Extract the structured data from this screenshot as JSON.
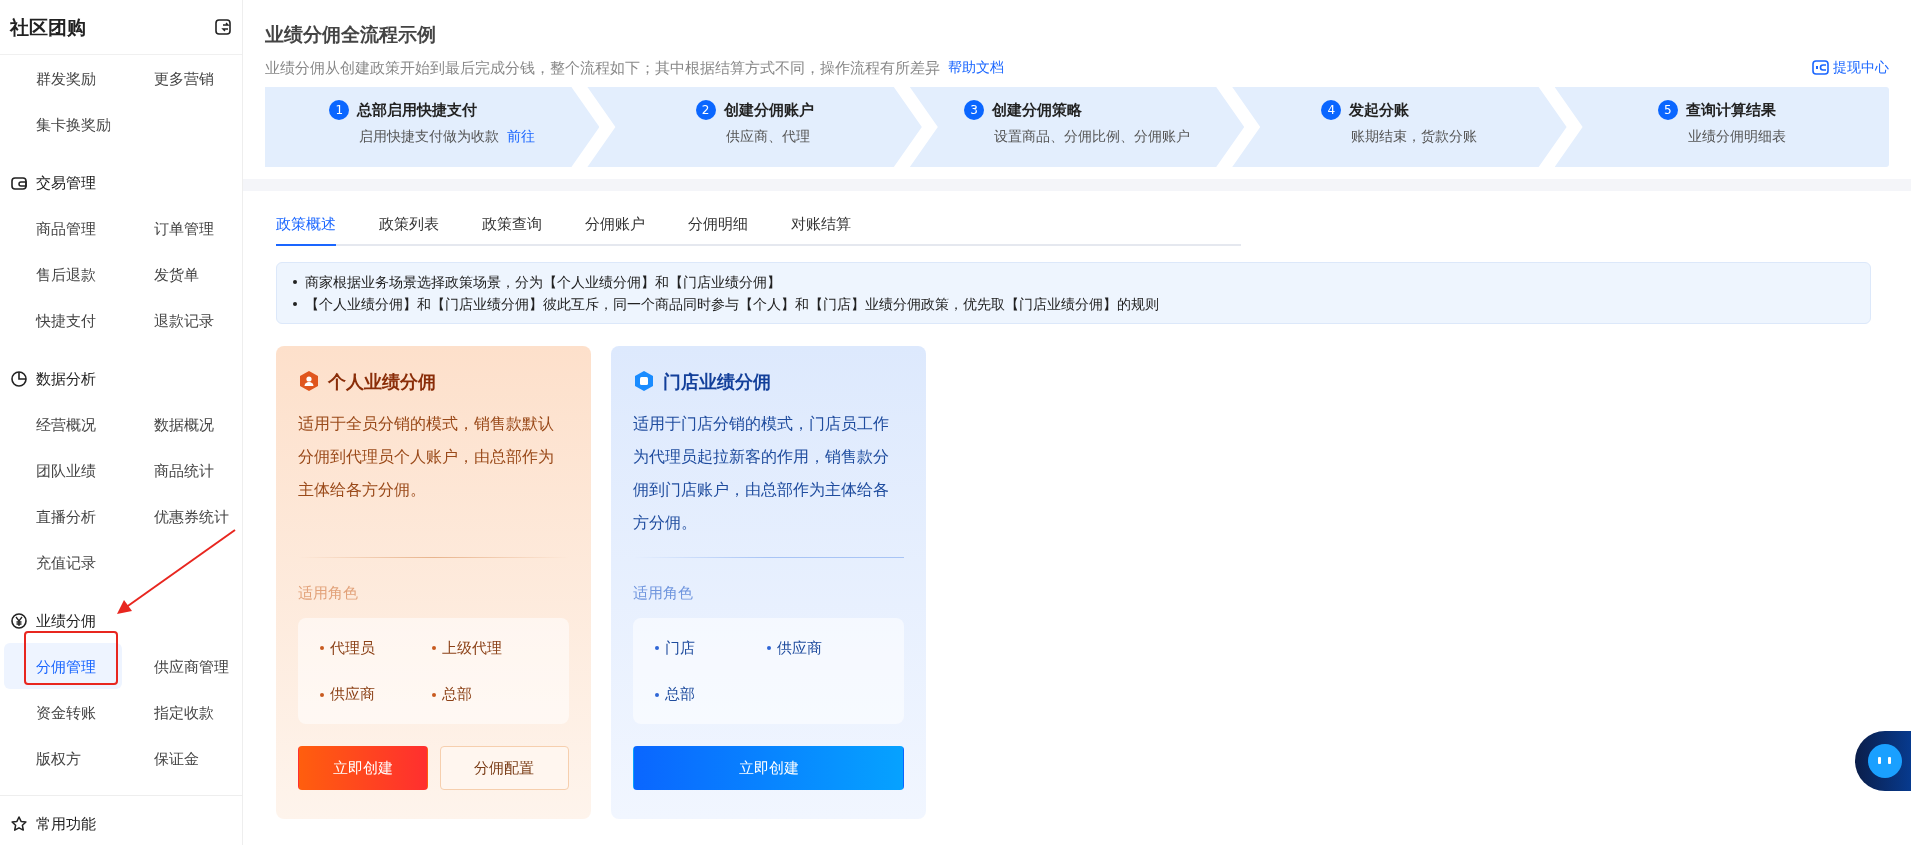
{
  "sidebar": {
    "title": "社区团购",
    "groups": [
      {
        "items": [
          {
            "label": "群发奖励",
            "selected": false
          },
          {
            "label": "更多营销",
            "selected": false
          },
          {
            "label": "集卡换奖励",
            "selected": false
          }
        ]
      },
      {
        "title": "交易管理",
        "items": [
          {
            "label": "商品管理",
            "selected": false
          },
          {
            "label": "订单管理",
            "selected": false
          },
          {
            "label": "售后退款",
            "selected": false
          },
          {
            "label": "发货单",
            "selected": false
          },
          {
            "label": "快捷支付",
            "selected": false
          },
          {
            "label": "退款记录",
            "selected": false
          }
        ]
      },
      {
        "title": "数据分析",
        "items": [
          {
            "label": "经营概况",
            "selected": false
          },
          {
            "label": "数据概况",
            "selected": false
          },
          {
            "label": "团队业绩",
            "selected": false
          },
          {
            "label": "商品统计",
            "selected": false
          },
          {
            "label": "直播分析",
            "selected": false
          },
          {
            "label": "优惠券统计",
            "selected": false
          },
          {
            "label": "充值记录",
            "selected": false
          }
        ]
      },
      {
        "title": "业绩分佣",
        "items": [
          {
            "label": "分佣管理",
            "selected": true
          },
          {
            "label": "供应商管理",
            "selected": false
          },
          {
            "label": "资金转账",
            "selected": false
          },
          {
            "label": "指定收款",
            "selected": false
          },
          {
            "label": "版权方",
            "selected": false
          },
          {
            "label": "保证金",
            "selected": false
          }
        ]
      },
      {
        "title": "常用功能"
      }
    ]
  },
  "header": {
    "title": "业绩分佣全流程示例",
    "subtitle": "业绩分佣从创建政策开始到最后完成分钱，整个流程如下；其中根据结算方式不同，操作流程有所差异",
    "help_link": "帮助文档",
    "withdraw_link": "提现中心"
  },
  "steps": [
    {
      "number": "1",
      "title": "总部启用快捷支付",
      "desc": "启用快捷支付做为收款",
      "link": "前往"
    },
    {
      "number": "2",
      "title": "创建分佣账户",
      "desc": "供应商、代理"
    },
    {
      "number": "3",
      "title": "创建分佣策略",
      "desc": "设置商品、分佣比例、分佣账户"
    },
    {
      "number": "4",
      "title": "发起分账",
      "desc": "账期结束，货款分账"
    },
    {
      "number": "5",
      "title": "查询计算结果",
      "desc": "业绩分佣明细表"
    }
  ],
  "tabs": [
    {
      "label": "政策概述",
      "selected": true
    },
    {
      "label": "政策列表",
      "selected": false
    },
    {
      "label": "政策查询",
      "selected": false
    },
    {
      "label": "分佣账户",
      "selected": false
    },
    {
      "label": "分佣明细",
      "selected": false
    },
    {
      "label": "对账结算",
      "selected": false
    }
  ],
  "notice": [
    "商家根据业务场景选择政策场景，分为【个人业绩分佣】和【门店业绩分佣】",
    "【个人业绩分佣】和【门店业绩分佣】彼此互斥，同一个商品同时参与【个人】和【门店】业绩分佣政策，优先取【门店业绩分佣】的规则"
  ],
  "cards": [
    {
      "kind": "personal",
      "title": "个人业绩分佣",
      "description": "适用于全员分销的模式，销售款默认分佣到代理员个人账户，由总部作为主体给各方分佣。",
      "roles_label": "适用角色",
      "roles": [
        "代理员",
        "上级代理",
        "供应商",
        "总部"
      ],
      "buttons": [
        {
          "label": "立即创建",
          "kind": "primary"
        },
        {
          "label": "分佣配置",
          "kind": "secondary"
        }
      ]
    },
    {
      "kind": "store",
      "title": "门店业绩分佣",
      "description": "适用于门店分销的模式，门店员工作为代理员起拉新客的作用，销售款分佣到门店账户，由总部作为主体给各方分佣。",
      "roles_label": "适用角色",
      "roles": [
        "门店",
        "供应商",
        "总部"
      ],
      "buttons": [
        {
          "label": "立即创建",
          "kind": "primary"
        }
      ]
    }
  ]
}
